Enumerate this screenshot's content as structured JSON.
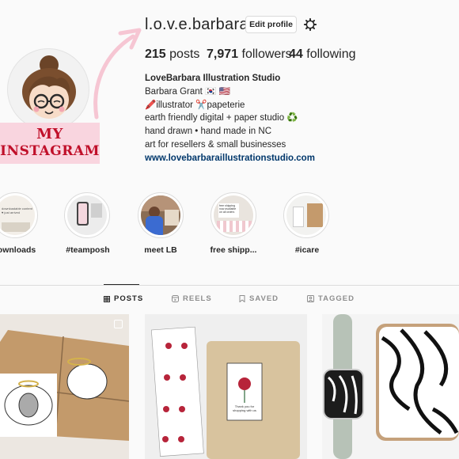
{
  "profile": {
    "username": "l.o.v.e.barbara",
    "edit_label": "Edit profile",
    "stats": {
      "posts": "215",
      "posts_label": "posts",
      "followers": "7,971",
      "followers_label": "followers",
      "following": "44",
      "following_label": "following"
    },
    "bio": {
      "name": "LoveBarbara Illustration Studio",
      "line1": "Barbara Grant 🇰🇷 🇺🇸",
      "line2": "🖍️illustrator ✂️papeterie",
      "line3": "earth friendly digital + paper studio ♻️",
      "line4": "hand drawn • hand made in NC",
      "line5": "art for resellers & small businesses",
      "link": "www.lovebarbaraillustrationstudio.com"
    }
  },
  "annotation": {
    "line1": "MY",
    "line2": "INSTAGRAM",
    "color": "#c0102a",
    "bg": "#f9d5df"
  },
  "highlights": [
    {
      "label": "ownloads",
      "thumb_text": "downloadable content ♥ just arrived"
    },
    {
      "label": "#teamposh"
    },
    {
      "label": "meet LB"
    },
    {
      "label": "free shipp...",
      "thumb_text": "free shipping now available on all orders"
    },
    {
      "label": "#icare"
    }
  ],
  "tabs": [
    {
      "label": "POSTS",
      "icon": "grid-icon",
      "active": true
    },
    {
      "label": "REELS",
      "icon": "reels-icon",
      "active": false
    },
    {
      "label": "SAVED",
      "icon": "bookmark-icon",
      "active": false
    },
    {
      "label": "TAGGED",
      "icon": "tagged-icon",
      "active": false
    }
  ],
  "posts": [
    {
      "alt_icon": "carousel-icon"
    },
    {
      "card_text": "Thank you for shopping with us"
    },
    {}
  ]
}
